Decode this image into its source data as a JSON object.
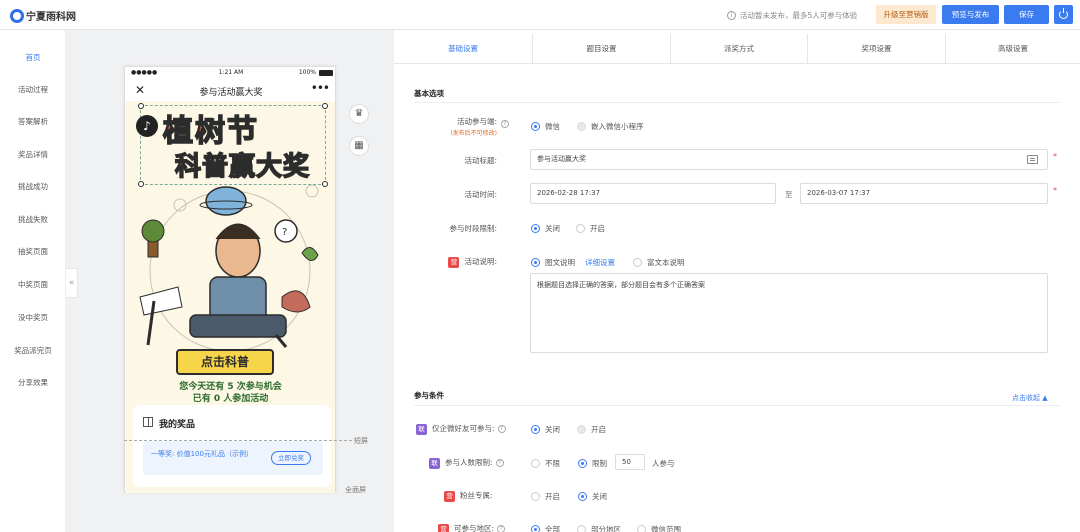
{
  "brand": "宁夏雨科网",
  "header": {
    "notice": "活动暂未发布，最多5人可参与体验",
    "upgrade_label": "升级至营销版",
    "preview_label": "预览与发布",
    "save_label": "保存"
  },
  "nav": {
    "items": [
      "首页",
      "活动过程",
      "答案解析",
      "奖品详情",
      "挑战成功",
      "挑战失败",
      "抽奖页面",
      "中奖页面",
      "没中奖页",
      "奖品派完页",
      "分享效果"
    ]
  },
  "phone": {
    "carrier": "●●●●●",
    "time": "1:21 AM",
    "battery": "100%",
    "title": "参与活动赢大奖",
    "poster_title_line1": "植树节",
    "poster_title_line2": "科普赢大奖",
    "cta": "点击科普",
    "chance_text": "您今天还有 5 次参与机会",
    "joined_text": "已有 0 人参加活动",
    "prize_title": "我的奖品",
    "prize_desc": "一等奖: 价值100元礼品（示例）",
    "redeem_label": "立即兑奖"
  },
  "canvas": {
    "short_label": "短屏",
    "full_label": "全面屏"
  },
  "tabs": [
    "基础设置",
    "题目设置",
    "派奖方式",
    "奖项设置",
    "高级设置"
  ],
  "basic": {
    "section_title": "基本选项",
    "client_label": "活动参与端:",
    "client_note": "(发布后不可修改)",
    "client_options": [
      "微信",
      "嵌入微信小程序"
    ],
    "title_label": "活动标题:",
    "title_value": "参与活动赢大奖",
    "time_label": "活动时间:",
    "time_start": "2026-02-28 17:37",
    "time_sep": "至",
    "time_end": "2026-03-07 17:37",
    "period_label": "参与时段限制:",
    "period_options": [
      "关闭",
      "开启"
    ],
    "desc_label": "活动说明:",
    "desc_options": [
      "图文说明",
      "富文本说明"
    ],
    "desc_link": "详细设置",
    "desc_text": "根据题目选择正确的答案，部分题目会有多个正确答案"
  },
  "conditions": {
    "section_title": "参与条件",
    "collapse_label": "点击收起",
    "wecom_label": "仅企微好友可参与:",
    "wecom_options": [
      "关闭",
      "开启"
    ],
    "limit_label": "参与人数限制:",
    "limit_options": [
      "不限",
      "限制"
    ],
    "limit_value": "50",
    "limit_unit": "人参与",
    "fans_label": "粉丝专属:",
    "fans_options": [
      "开启",
      "关闭"
    ],
    "region_label": "可参与地区:",
    "region_options": [
      "全部",
      "部分地区",
      "微信范围"
    ],
    "tag_red": "营",
    "tag_purple": "联"
  }
}
